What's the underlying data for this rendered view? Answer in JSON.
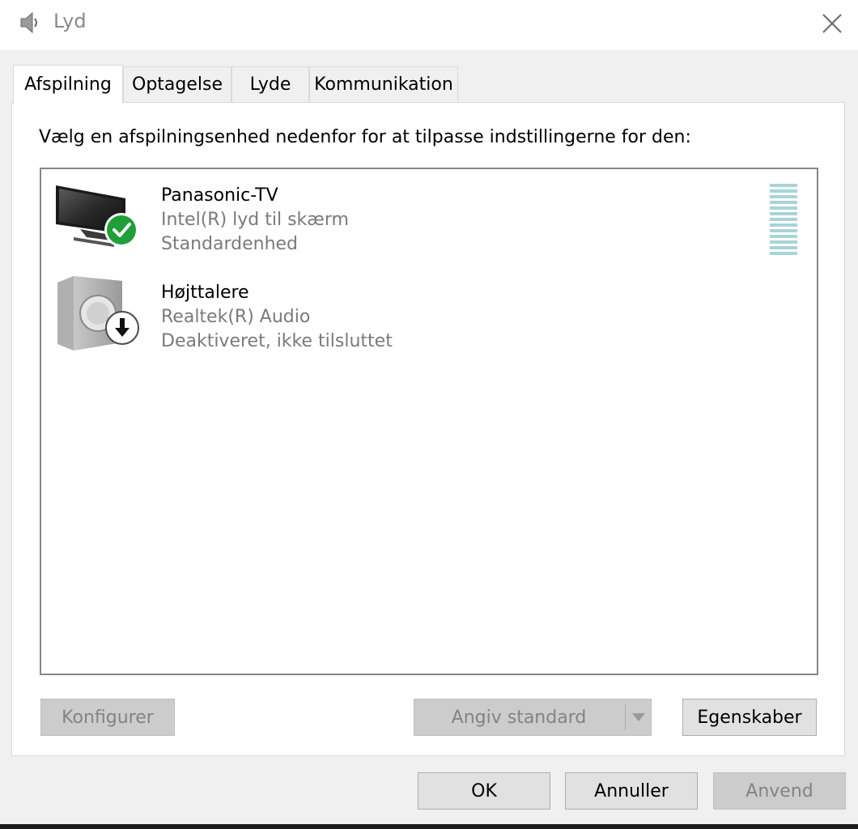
{
  "window": {
    "title": "Lyd"
  },
  "tabs": [
    {
      "label": "Afspilning",
      "active": true
    },
    {
      "label": "Optagelse",
      "active": false
    },
    {
      "label": "Lyde",
      "active": false
    },
    {
      "label": "Kommunikation",
      "active": false
    }
  ],
  "playback": {
    "instruction": "Vælg en afspilningsenhed nedenfor for at tilpasse indstillingerne for den:",
    "devices": [
      {
        "name": "Panasonic-TV",
        "driver": "Intel(R) lyd til skærm",
        "status": "Standardenhed",
        "icon": "tv-icon",
        "badge": "green-check-icon",
        "selected": false
      },
      {
        "name": "Højttalere",
        "driver": "Realtek(R) Audio",
        "status": "Deaktiveret, ikke tilsluttet",
        "icon": "speaker-icon",
        "badge": "down-arrow-icon",
        "selected": false
      }
    ],
    "buttons": {
      "configure": "Konfigurer",
      "set_default": "Angiv standard",
      "properties": "Egenskaber"
    }
  },
  "dialog_buttons": {
    "ok": "OK",
    "cancel": "Annuller",
    "apply": "Anvend"
  },
  "colors": {
    "check_green": "#1f9e3a",
    "meter": "#a8d4d8",
    "disabled_text": "#838383"
  }
}
